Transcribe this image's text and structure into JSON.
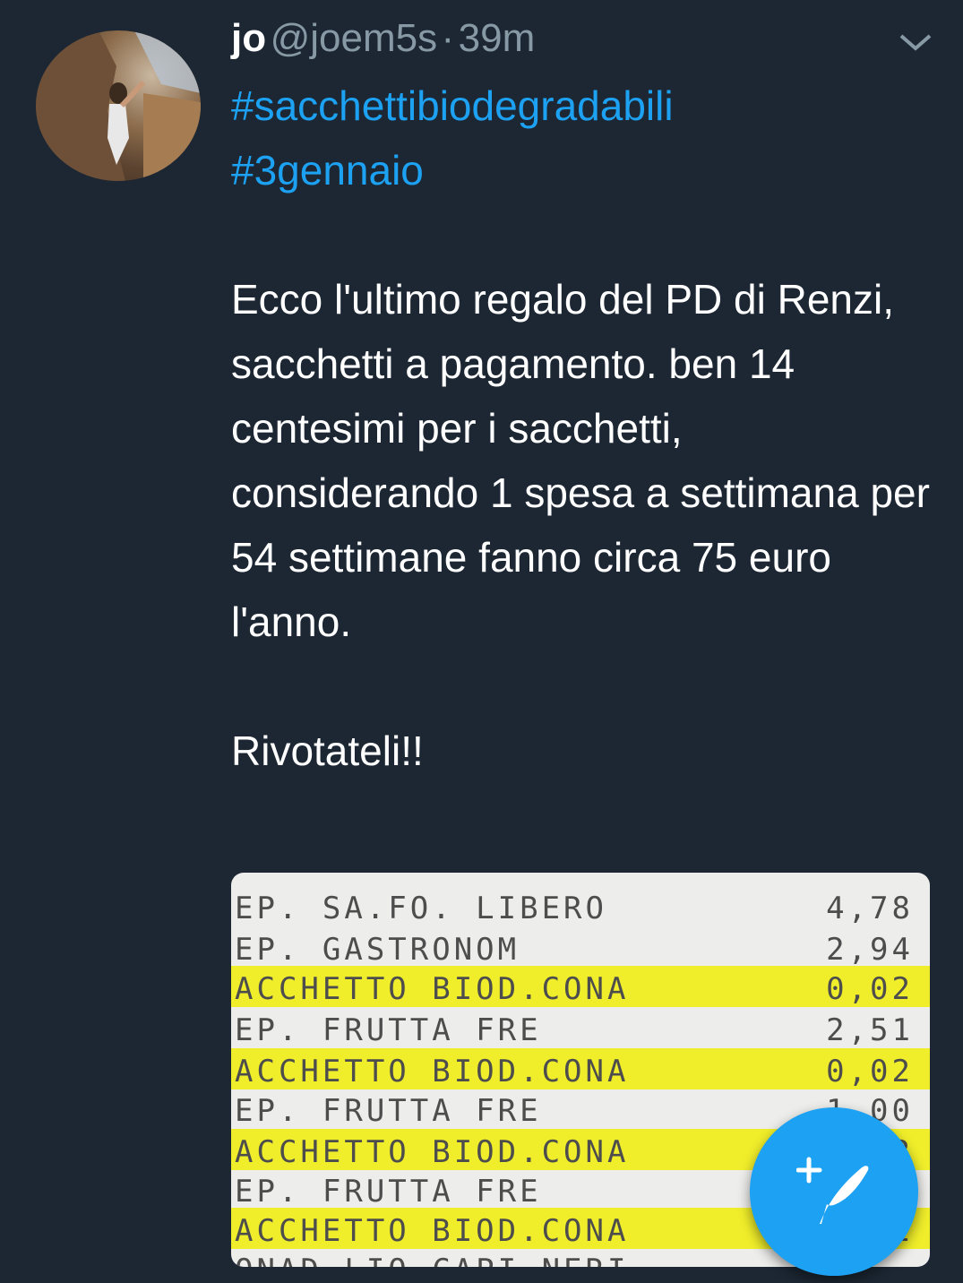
{
  "tweet": {
    "author_name": "jo",
    "handle": "@joem5s",
    "separator": "·",
    "time": "39m",
    "hashtag1": "#sacchettibiodegradabili",
    "hashtag2": "#3gennaio",
    "body": "\n\nEcco l'ultimo regalo del PD di Renzi, sacchetti a pagamento. ben 14 centesimi per i sacchetti, considerando 1 spesa a settimana per 54 settimane fanno circa 75 euro l'anno.\n\nRivotateli!!"
  },
  "receipt": {
    "rows": [
      {
        "item": "EP. SA.FO. LIBERO",
        "amount": "4,78"
      },
      {
        "item": "EP.   GASTRONOM",
        "amount": "2,94"
      },
      {
        "item": "ACCHETTO BIOD.CONA",
        "amount": "0,02"
      },
      {
        "item": "EP. FRUTTA FRE",
        "amount": "2,51"
      },
      {
        "item": "ACCHETTO BIOD.CONA",
        "amount": "0,02"
      },
      {
        "item": "EP. FRUTTA FRE",
        "amount": "1,00"
      },
      {
        "item": "ACCHETTO BIOD.CONA",
        "amount": "0,02"
      },
      {
        "item": "EP. FRUTTA FRE",
        "amount": ""
      },
      {
        "item": "ACCHETTO BIOD.CONA",
        "amount": "0,02"
      },
      {
        "item": "ONAD LIQ CAPI NERI",
        "amount": ""
      }
    ]
  },
  "icons": {
    "menu": "chevron-down-icon",
    "compose": "compose-tweet-icon"
  },
  "colors": {
    "background": "#1c2733",
    "link": "#1da1f2",
    "secondary_text": "#8899a6",
    "highlight": "#f0ee2a"
  }
}
